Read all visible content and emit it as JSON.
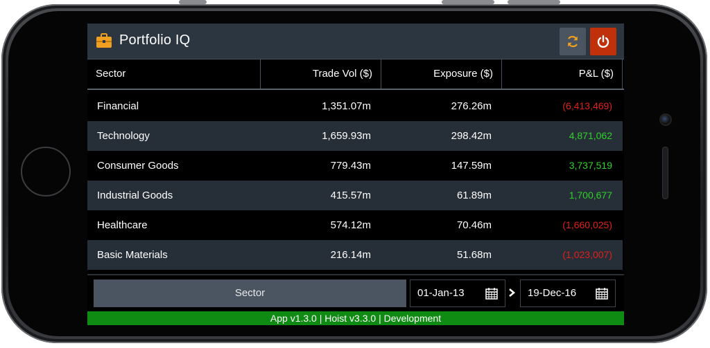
{
  "app": {
    "title": "Portfolio IQ",
    "icons": {
      "brand": "briefcase-icon",
      "refresh": "refresh-icon",
      "logout": "power-icon"
    }
  },
  "grid": {
    "columns": [
      "Sector",
      "Trade Vol ($)",
      "Exposure ($)",
      "P&L ($)"
    ],
    "rows": [
      {
        "sector": "Financial",
        "trade_vol": "1,351.07m",
        "exposure": "276.26m",
        "pnl": "(6,413,469)",
        "pnl_sign": "neg"
      },
      {
        "sector": "Technology",
        "trade_vol": "1,659.93m",
        "exposure": "298.42m",
        "pnl": "4,871,062",
        "pnl_sign": "pos"
      },
      {
        "sector": "Consumer Goods",
        "trade_vol": "779.43m",
        "exposure": "147.59m",
        "pnl": "3,737,519",
        "pnl_sign": "pos"
      },
      {
        "sector": "Industrial Goods",
        "trade_vol": "415.57m",
        "exposure": "61.89m",
        "pnl": "1,700,677",
        "pnl_sign": "pos"
      },
      {
        "sector": "Healthcare",
        "trade_vol": "574.12m",
        "exposure": "70.46m",
        "pnl": "(1,660,025)",
        "pnl_sign": "neg"
      },
      {
        "sector": "Basic Materials",
        "trade_vol": "216.14m",
        "exposure": "51.68m",
        "pnl": "(1,023,007)",
        "pnl_sign": "neg"
      }
    ]
  },
  "toolbar": {
    "group_by_label": "Sector",
    "start_date": "01-Jan-13",
    "end_date": "19-Dec-16"
  },
  "status": {
    "text": "App v1.3.0 | Hoist v3.3.0 | Development"
  },
  "colors": {
    "header_bg": "#2c3641",
    "row_alt_bg": "#262e37",
    "accent_orange": "#f0a020",
    "power_red": "#c0300b",
    "negative": "#e0201b",
    "positive": "#2fd12a",
    "status_green": "#0f8a12"
  }
}
